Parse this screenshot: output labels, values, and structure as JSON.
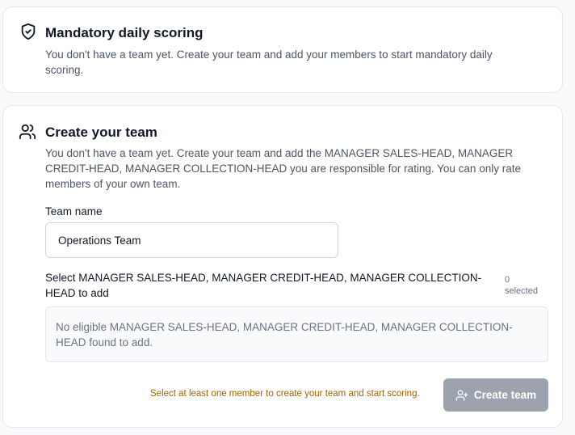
{
  "scoring_card": {
    "icon": "shield-check-icon",
    "title": "Mandatory daily scoring",
    "description": "You don't have a team yet. Create your team and add your members to start mandatory daily scoring."
  },
  "team_card": {
    "icon": "users-icon",
    "title": "Create your team",
    "description": "You don't have a team yet. Create your team and add the MANAGER SALES-HEAD, MANAGER CREDIT-HEAD, MANAGER COLLECTION-HEAD you are responsible for rating. You can only rate members of your own team.",
    "team_name_label": "Team name",
    "team_name_value": "Operations Team",
    "select_label": "Select MANAGER SALES-HEAD, MANAGER CREDIT-HEAD, MANAGER COLLECTION-HEAD to add",
    "selected_count": "0",
    "selected_text": "selected",
    "empty_message": "No eligible MANAGER SALES-HEAD, MANAGER CREDIT-HEAD, MANAGER COLLECTION-HEAD found to add.",
    "warning": "Select at least one member to create your team and start scoring.",
    "create_button": "Create team",
    "create_button_icon": "user-plus-icon"
  },
  "colors": {
    "warning_text": "#a16207",
    "button_disabled": "#9ca3af",
    "border": "#e5e7eb"
  }
}
